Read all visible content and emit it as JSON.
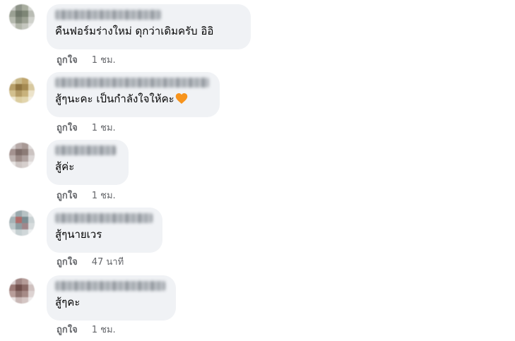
{
  "comments": [
    {
      "text": "คืนฟอร์มร่างใหม่ ดุกว่าเดิมครับ อิอิ",
      "like_label": "ถูกใจ",
      "time": "1 ชม.",
      "has_heart": false
    },
    {
      "text": "สู้ๆนะคะ เป็นกำลังใจให้คะ",
      "like_label": "ถูกใจ",
      "time": "1 ชม.",
      "has_heart": true,
      "emoji_icon": "orange-heart-icon",
      "emoji_color": "#f7941d"
    },
    {
      "text": "สู้ค่ะ",
      "like_label": "ถูกใจ",
      "time": "1 ชม.",
      "has_heart": false
    },
    {
      "text": "สู้ๆนายเวร",
      "like_label": "ถูกใจ",
      "time": "47 นาที",
      "has_heart": false
    },
    {
      "text": "สู้ๆคะ",
      "like_label": "ถูกใจ",
      "time": "1 ชม.",
      "has_heart": false
    }
  ],
  "colors": {
    "bubble_bg": "#f0f2f5",
    "secondary_text": "#65676b",
    "primary_text": "#050505"
  }
}
